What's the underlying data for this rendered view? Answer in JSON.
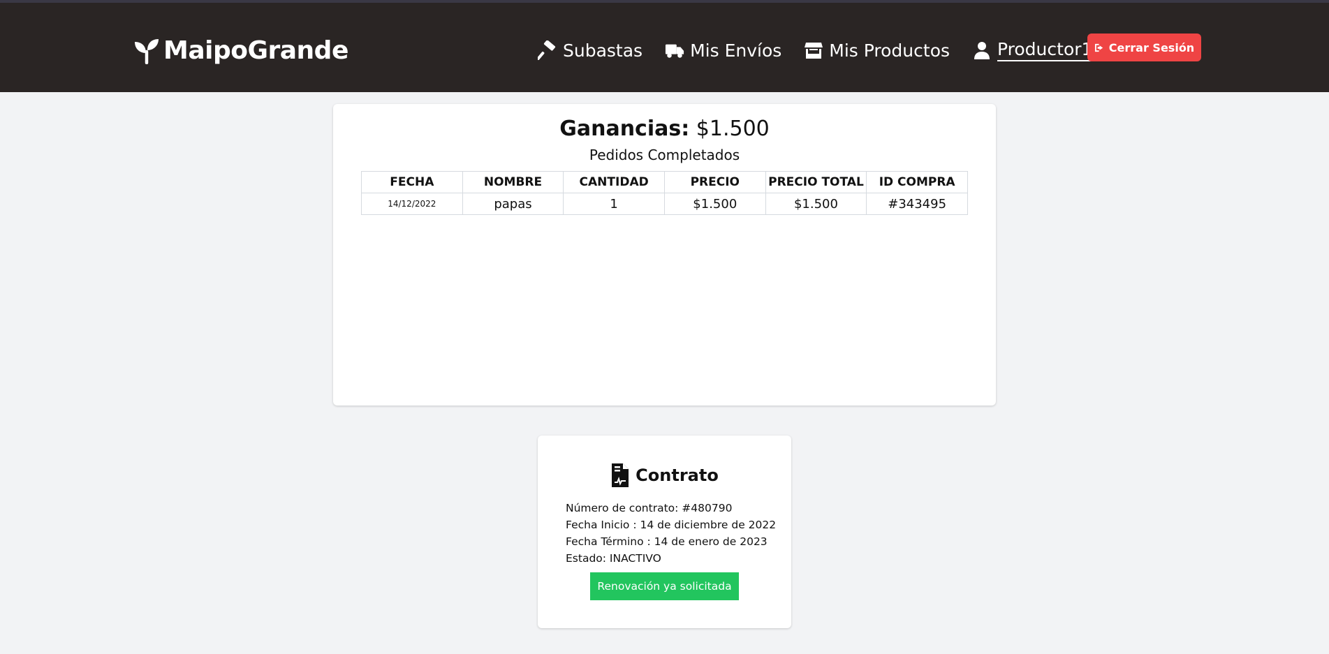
{
  "brand": {
    "name": "MaipoGrande",
    "icon": "seedling-icon"
  },
  "nav": {
    "items": [
      {
        "label": "Subastas",
        "icon": "gavel-icon"
      },
      {
        "label": "Mis Envíos",
        "icon": "truck-icon"
      },
      {
        "label": "Mis Productos",
        "icon": "store-icon"
      }
    ],
    "user": {
      "label": "Productor1",
      "icon": "user-icon"
    },
    "logout_label": "Cerrar Sesión",
    "logout_icon": "sign-out-icon"
  },
  "earnings": {
    "label": "Ganancias:",
    "value": "$1.500",
    "subtitle": "Pedidos Completados",
    "columns": [
      "FECHA",
      "NOMBRE",
      "CANTIDAD",
      "PRECIO",
      "PRECIO TOTAL",
      "ID COMPRA"
    ],
    "rows": [
      [
        "14/12/2022",
        "papas",
        "1",
        "$1.500",
        "$1.500",
        "#343495"
      ]
    ]
  },
  "contract": {
    "title": "Contrato",
    "icon": "file-contract-icon",
    "lines": {
      "number": "Número de contrato: #480790",
      "start": "Fecha Inicio : 14 de diciembre de 2022",
      "end": "Fecha Término : 14 de enero de 2023",
      "status": "Estado: INACTIVO"
    },
    "renew_label": "Renovación ya solicitada"
  },
  "colors": {
    "navbar": "#2a2524",
    "page_background": "#f2f3f5",
    "logout_button": "#ef4444",
    "renew_button": "#22c55e"
  }
}
